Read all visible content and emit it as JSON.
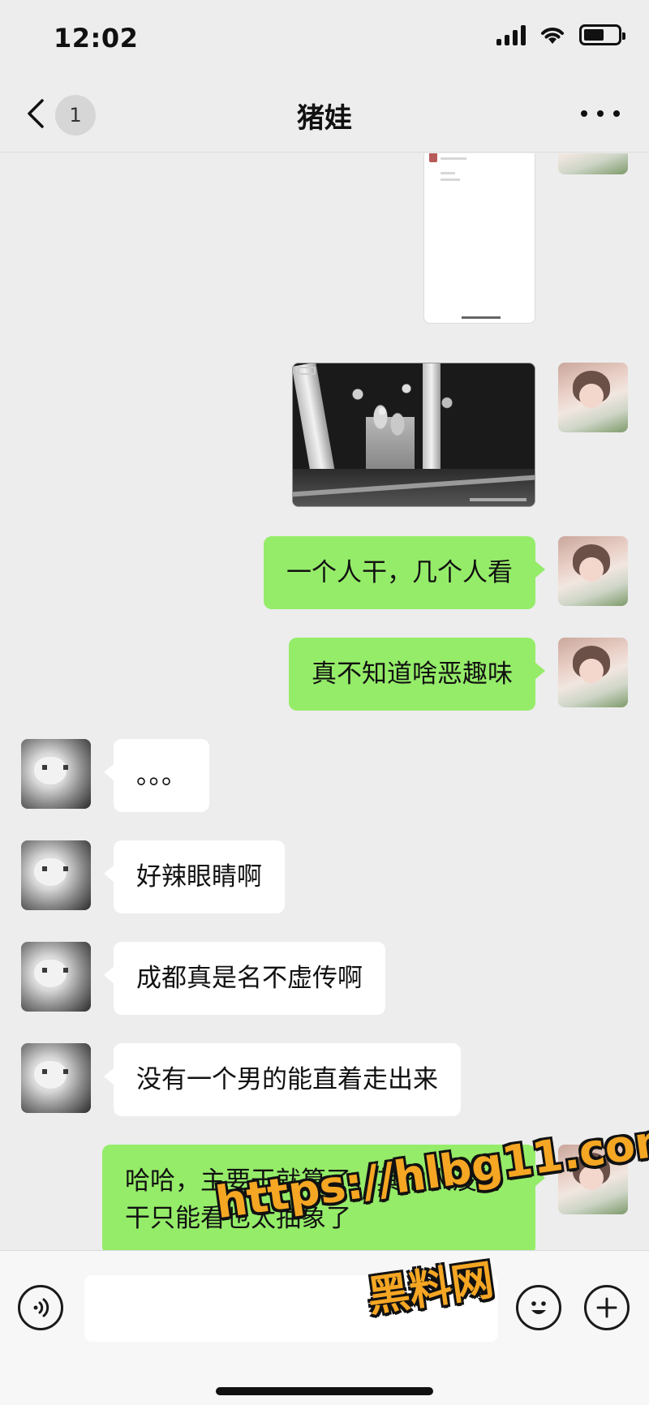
{
  "status_bar": {
    "time": "12:02",
    "battery_level": 0.6
  },
  "header": {
    "unread_count": "1",
    "title": "猪娃"
  },
  "messages": [
    {
      "sender": "self",
      "type": "image",
      "content": "chat-screenshot"
    },
    {
      "sender": "self",
      "type": "image",
      "content": "night-surveillance-photo"
    },
    {
      "sender": "self",
      "type": "text",
      "text": "一个人干，几个人看"
    },
    {
      "sender": "self",
      "type": "text",
      "text": "真不知道啥恶趣味"
    },
    {
      "sender": "other",
      "type": "text",
      "text": "。。。"
    },
    {
      "sender": "other",
      "type": "text",
      "text": "好辣眼睛啊"
    },
    {
      "sender": "other",
      "type": "text",
      "text": "成都真是名不虚传啊"
    },
    {
      "sender": "other",
      "type": "text",
      "text": "没有一个男的能直着走出来"
    },
    {
      "sender": "self",
      "type": "text",
      "text": "哈哈，主要干就算了，其他人没的干只能看也太抽象了"
    }
  ],
  "input_bar": {
    "icons": [
      "voice-icon",
      "emoji-icon",
      "plus-icon"
    ]
  },
  "watermark": {
    "url": "https://hlbg11.com",
    "name": "黑料网"
  },
  "colors": {
    "background": "#ededed",
    "self_bubble": "#95ec69",
    "other_bubble": "#ffffff",
    "watermark": "#f5a623"
  }
}
